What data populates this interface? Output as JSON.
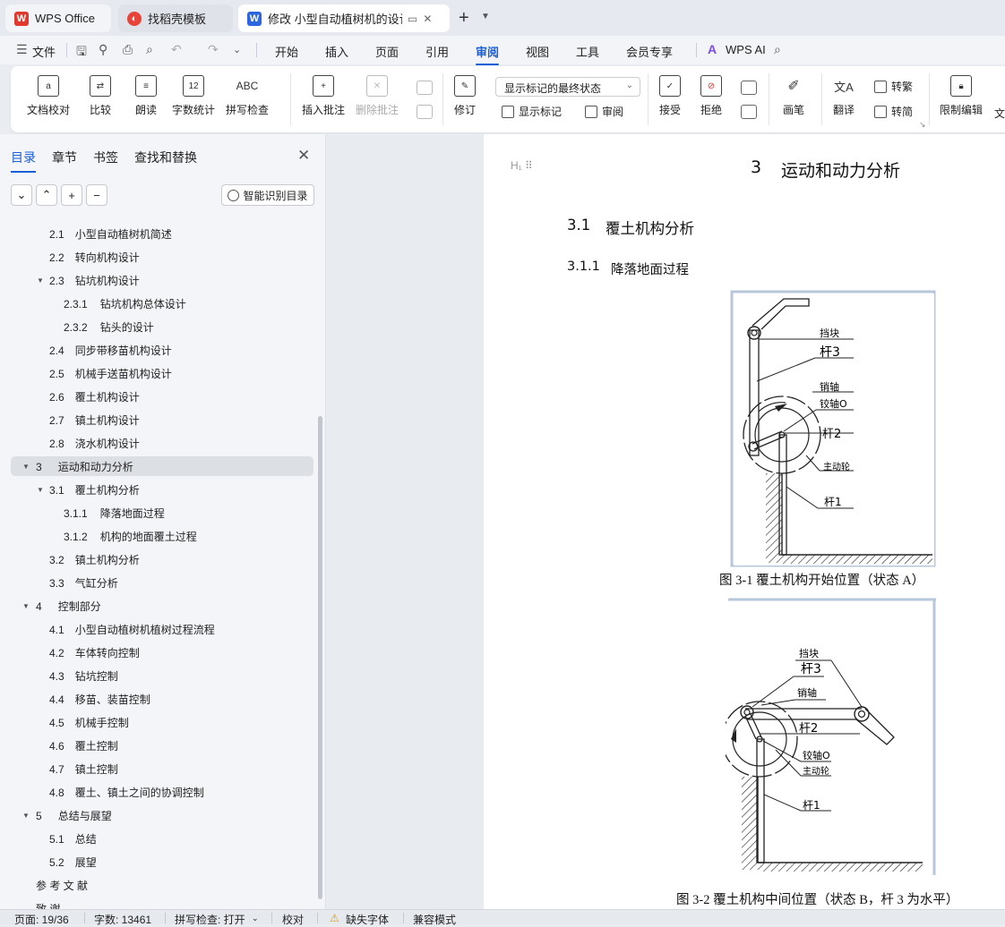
{
  "tabs": [
    {
      "label": "WPS Office"
    },
    {
      "label": "找稻壳模板"
    },
    {
      "label": "修改 小型自动植树机的设计.docx"
    }
  ],
  "menu": {
    "file": "文件",
    "items": [
      "开始",
      "插入",
      "页面",
      "引用",
      "审阅",
      "视图",
      "工具",
      "会员专享"
    ],
    "active": "审阅",
    "wps_ai": "WPS AI"
  },
  "ribbon": {
    "doc_check": "文档校对",
    "compare": "比较",
    "read_aloud": "朗读",
    "word_count": "字数统计",
    "word_count_icon": "12",
    "spell_check": "拼写检查",
    "spell_icon": "ABC",
    "insert_comment": "插入批注",
    "delete_comment": "删除批注",
    "revise": "修订",
    "markup_mode": "显示标记的最终状态",
    "show_markup": "显示标记",
    "review": "审阅",
    "accept": "接受",
    "reject": "拒绝",
    "pen": "画笔",
    "translate": "翻译",
    "to_traditional": "转繁",
    "to_simplified": "转简",
    "restrict_edit": "限制编辑",
    "more": "文"
  },
  "sidebar": {
    "tabs": [
      "目录",
      "章节",
      "书签",
      "查找和替换"
    ],
    "smart_toc": "智能识别目录",
    "toc": [
      {
        "num": "2.1",
        "title": "小型自动植树机简述",
        "level": 2
      },
      {
        "num": "2.2",
        "title": "转向机构设计",
        "level": 2
      },
      {
        "num": "2.3",
        "title": "钻坑机构设计",
        "level": 2,
        "expanded": true
      },
      {
        "num": "2.3.1",
        "title": "钻坑机构总体设计",
        "level": 3
      },
      {
        "num": "2.3.2",
        "title": "钻头的设计",
        "level": 3
      },
      {
        "num": "2.4",
        "title": "同步带移苗机构设计",
        "level": 2
      },
      {
        "num": "2.5",
        "title": "机械手送苗机构设计",
        "level": 2
      },
      {
        "num": "2.6",
        "title": "覆土机构设计",
        "level": 2
      },
      {
        "num": "2.7",
        "title": "镇土机构设计",
        "level": 2
      },
      {
        "num": "2.8",
        "title": "浇水机构设计",
        "level": 2
      },
      {
        "num": "3",
        "title": "运动和动力分析",
        "level": 1,
        "expanded": true,
        "selected": true
      },
      {
        "num": "3.1",
        "title": "覆土机构分析",
        "level": 2,
        "expanded": true
      },
      {
        "num": "3.1.1",
        "title": "降落地面过程",
        "level": 3
      },
      {
        "num": "3.1.2",
        "title": "机构的地面覆土过程",
        "level": 3
      },
      {
        "num": "3.2",
        "title": "镇土机构分析",
        "level": 2
      },
      {
        "num": "3.3",
        "title": "气缸分析",
        "level": 2
      },
      {
        "num": "4",
        "title": "控制部分",
        "level": 1,
        "expanded": true
      },
      {
        "num": "4.1",
        "title": "小型自动植树机植树过程流程",
        "level": 2
      },
      {
        "num": "4.2",
        "title": "车体转向控制",
        "level": 2
      },
      {
        "num": "4.3",
        "title": "钻坑控制",
        "level": 2
      },
      {
        "num": "4.4",
        "title": "移苗、装苗控制",
        "level": 2
      },
      {
        "num": "4.5",
        "title": "机械手控制",
        "level": 2
      },
      {
        "num": "4.6",
        "title": "覆土控制",
        "level": 2
      },
      {
        "num": "4.7",
        "title": "镇土控制",
        "level": 2
      },
      {
        "num": "4.8",
        "title": "覆土、镇土之间的协调控制",
        "level": 2
      },
      {
        "num": "5",
        "title": "总结与展望",
        "level": 1,
        "expanded": true
      },
      {
        "num": "5.1",
        "title": "总结",
        "level": 2
      },
      {
        "num": "5.2",
        "title": "展望",
        "level": 2
      },
      {
        "num": "",
        "title": "参 考 文 献",
        "level": 0
      },
      {
        "num": "",
        "title": "致 谢",
        "level": 0
      }
    ]
  },
  "document": {
    "heading1_num": "3",
    "heading1": "运动和动力分析",
    "heading2_num": "3.1",
    "heading2": "覆土机构分析",
    "heading3_num": "3.1.1",
    "heading3": "降落地面过程",
    "fig1": {
      "caption": "图 3-1 覆土机构开始位置（状态 A）",
      "labels": {
        "block": "挡块",
        "rod3": "杆3",
        "pin": "销轴",
        "hinge_o": "铰轴O",
        "rod2": "杆2",
        "wheel": "主动轮",
        "rod1": "杆1"
      }
    },
    "fig2": {
      "caption": "图 3-2 覆土机构中间位置（状态 B，杆 3 为水平）",
      "labels": {
        "block": "挡块",
        "rod3": "杆3",
        "pin": "销轴",
        "rod2": "杆2",
        "hinge_o": "铰轴O",
        "wheel": "主动轮",
        "rod1": "杆1"
      }
    }
  },
  "status": {
    "page": "页面: 19/36",
    "words": "字数: 13461",
    "spell": "拼写检查: 打开",
    "proof": "校对",
    "missing_font": "缺失字体",
    "compat": "兼容模式"
  }
}
